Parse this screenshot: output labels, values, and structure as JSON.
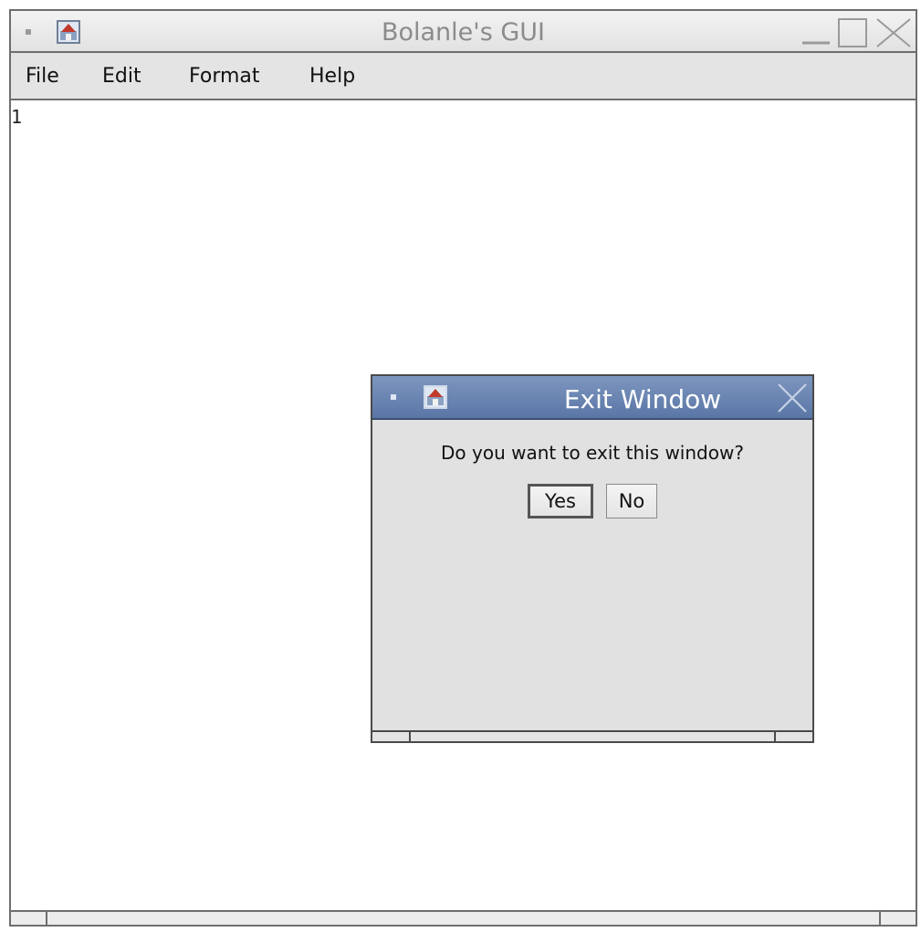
{
  "main_window": {
    "title": "Bolanle's GUI",
    "menu": [
      {
        "label": "File"
      },
      {
        "label": "Edit"
      },
      {
        "label": "Format"
      },
      {
        "label": "Help"
      }
    ],
    "editor_content": "1",
    "icons": {
      "window_menu": "window-menu-dot-icon",
      "app": "java-app-icon",
      "minimize": "minimize-icon",
      "maximize": "maximize-icon",
      "close": "close-icon"
    }
  },
  "dialog": {
    "title": "Exit Window",
    "message": "Do you want to exit this window?",
    "buttons": {
      "yes": "Yes",
      "no": "No"
    },
    "icons": {
      "window_menu": "window-menu-dot-icon",
      "app": "java-app-icon",
      "close": "close-icon"
    }
  },
  "colors": {
    "dialog_titlebar": "#5a76a6",
    "window_background": "#e4e4e4",
    "border": "#6e6e6e"
  }
}
